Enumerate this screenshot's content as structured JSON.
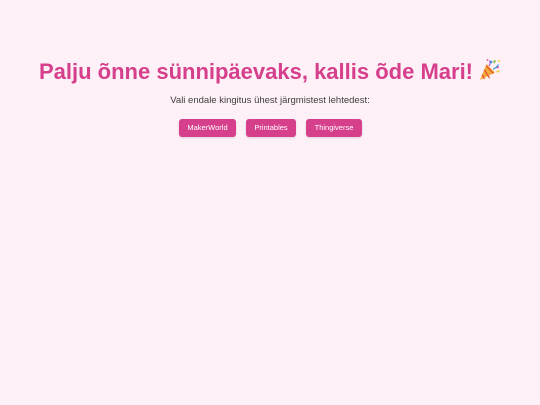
{
  "header": {
    "title": "Palju õnne sünnipäevaks, kallis õde Mari!",
    "title_icon": "party-popper-icon",
    "subtitle": "Vali endale kingitus ühest järgmistest lehtedest:"
  },
  "links": [
    {
      "label": "MakerWorld"
    },
    {
      "label": "Printables"
    },
    {
      "label": "Thingiverse"
    }
  ],
  "colors": {
    "background": "#fdf0f6",
    "accent": "#d63f8c",
    "button_text": "#ffffff",
    "body_text": "#3e3e3e"
  }
}
